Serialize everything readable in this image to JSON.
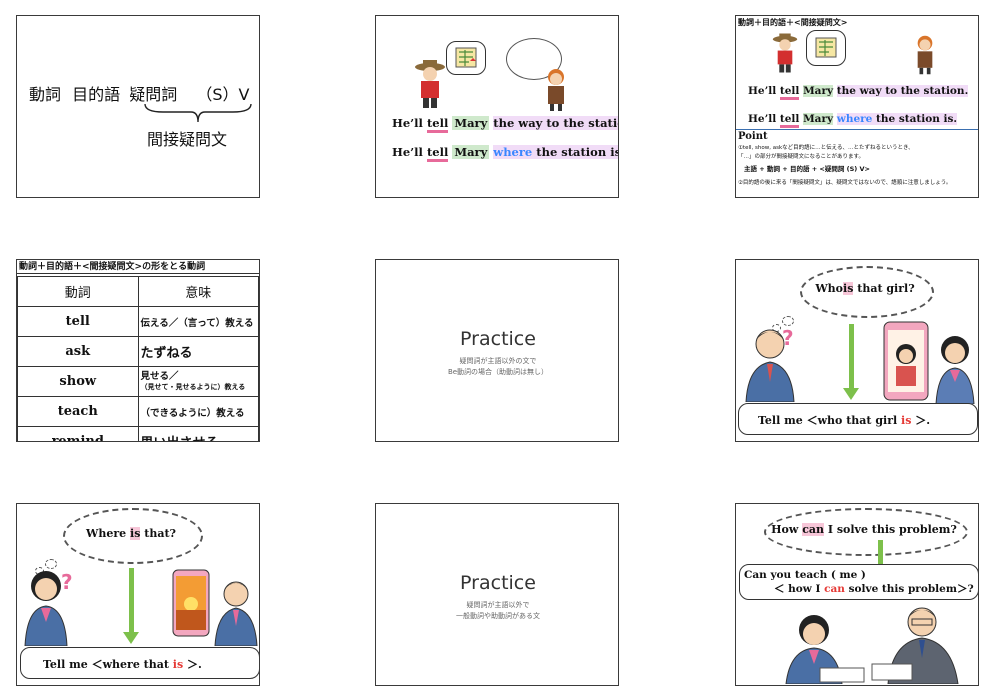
{
  "slide1": {
    "verb": "動詞",
    "object": "目的語",
    "interrogative": "疑問詞",
    "sv": "（S）V",
    "label": "間接疑問文"
  },
  "slide2": {
    "sentence1": {
      "he": "He’ll",
      "tell": "tell",
      "mary": "Mary",
      "rest": "the way to the station."
    },
    "sentence2": {
      "he": "He’ll",
      "tell": "tell",
      "mary": "Mary",
      "where": "where",
      "rest": "the station is."
    }
  },
  "slide3": {
    "title": "動詞＋目的語＋<間接疑問文>",
    "sentence1": {
      "he": "He’ll",
      "tell": "tell",
      "mary": "Mary",
      "rest": "the way to the station."
    },
    "sentence2": {
      "he": "He’ll",
      "tell": "tell",
      "mary": "Mary",
      "where": "where",
      "rest": "the station is."
    },
    "point_title": "Point",
    "point1": "①tell, show, askなど目的語に…と伝える、…とたずねるというとき、",
    "point1b": "「…」の部分が間接疑問文になることがあります。",
    "formula": "主語 + 動詞 + 目的語 + <疑問詞 (S) V>",
    "point2": "②目的語の後に来る「間接疑問文」は、疑問文ではないので、語順に注意しましょう。"
  },
  "slide4": {
    "title": "動詞＋目的語＋<間接疑問文>の形をとる動詞",
    "col_verb": "動詞",
    "col_meaning": "意味",
    "rows": [
      {
        "verb": "tell",
        "meaning": "伝える／（言って）教える"
      },
      {
        "verb": "ask",
        "meaning": "たずねる"
      },
      {
        "verb": "show",
        "meaning": "見せる／",
        "meaning2": "（見せて・見せるように）教える"
      },
      {
        "verb": "teach",
        "meaning": "（できるように）教える"
      },
      {
        "verb": "remind",
        "meaning": "思い出させる"
      }
    ]
  },
  "slide5": {
    "title": "Practice",
    "line1": "疑問詞が主語以外の文で",
    "line2": "Be動詞の場合（助動詞は無し）"
  },
  "slide6": {
    "question_pre": "Who",
    "question_hl": "is",
    "question_post": "that girl?",
    "answer_pre": "Tell me ＜who that girl",
    "answer_red": "is",
    "answer_post": "＞."
  },
  "slide7": {
    "question_pre": "Where",
    "question_hl": "is",
    "question_post": "that?",
    "answer_pre": "Tell me ＜where that",
    "answer_red": "is",
    "answer_post": "＞."
  },
  "slide8": {
    "title": "Practice",
    "line1": "疑問詞が主語以外で",
    "line2": "一般動詞や助動詞がある文"
  },
  "slide9": {
    "question_pre": "How",
    "question_hl": "can",
    "question_post": "I solve this problem?",
    "answer_line1": "Can you teach ( me )",
    "answer_pre": "＜ how I",
    "answer_red": "can",
    "answer_post": "solve this problem＞?"
  },
  "colors": {
    "pink_highlight": "#f7c6d8",
    "green_highlight": "#cfe9cc",
    "violet_highlight": "#f1dcf7",
    "blue_word": "#3a86ff",
    "red_word": "#e53935",
    "arrow_green": "#7dc04b"
  }
}
